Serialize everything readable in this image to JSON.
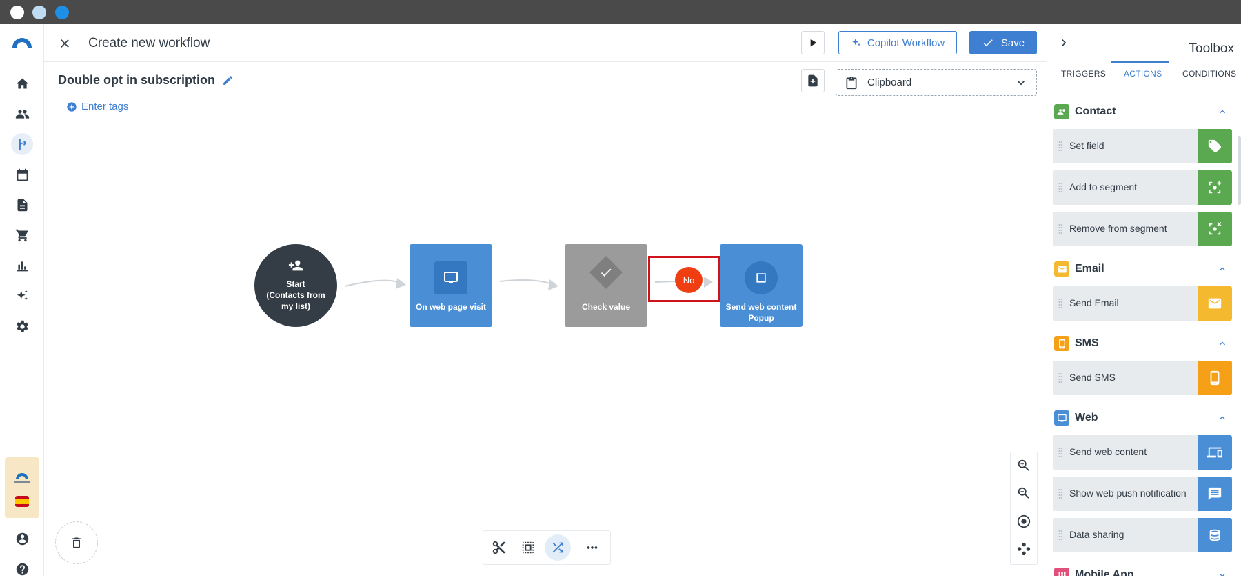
{
  "header": {
    "title": "Create new workflow",
    "copilot_label": "Copilot Workflow",
    "save_label": "Save"
  },
  "workflow": {
    "name": "Double opt in subscription",
    "tags_label": "Enter tags",
    "clipboard_label": "Clipboard"
  },
  "nodes": {
    "start": "Start\n(Contacts from my list)",
    "web_visit": "On web page visit",
    "check_value": "Check value",
    "branch_label": "No",
    "send_popup": "Send web content Popup"
  },
  "toolbox": {
    "title": "Toolbox",
    "tabs": [
      "TRIGGERS",
      "ACTIONS",
      "CONDITIONS"
    ],
    "active_tab": "ACTIONS",
    "sections": {
      "contact": {
        "title": "Contact",
        "items": [
          "Set field",
          "Add to segment",
          "Remove from segment"
        ]
      },
      "email": {
        "title": "Email",
        "items": [
          "Send Email"
        ]
      },
      "sms": {
        "title": "SMS",
        "items": [
          "Send SMS"
        ]
      },
      "web": {
        "title": "Web",
        "items": [
          "Send web content",
          "Show web push notification",
          "Data sharing"
        ]
      },
      "mobile": {
        "title": "Mobile App"
      }
    }
  },
  "colors": {
    "contact": "#5aa84f",
    "email": "#f5b930",
    "sms": "#f5a016",
    "web": "#4a8fd6",
    "primary": "#3f7fd1",
    "branch_no": "#ef3f12"
  }
}
